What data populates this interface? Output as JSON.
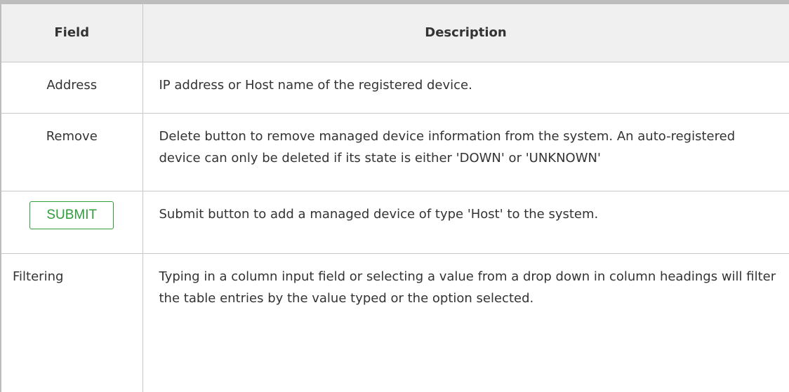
{
  "table": {
    "headers": {
      "field": "Field",
      "description": "Description"
    },
    "rows": [
      {
        "field": "Address",
        "description": "IP address or Host name of the registered device."
      },
      {
        "field": "Remove",
        "description": "Delete button to remove managed device information from the system. An auto-registered device can only be deleted if its state is either 'DOWN' or 'UNKNOWN'"
      },
      {
        "field": "SUBMIT",
        "description": "Submit button to add a managed device of type 'Host' to the system."
      },
      {
        "field": "Filtering",
        "description": "Typing in a column input field or selecting a value from a drop down in column headings will filter the table entries by the value typed or the option selected."
      }
    ]
  },
  "colors": {
    "submit_accent": "#2e9d3a",
    "header_background": "#f0f0f0",
    "text": "#333333"
  }
}
